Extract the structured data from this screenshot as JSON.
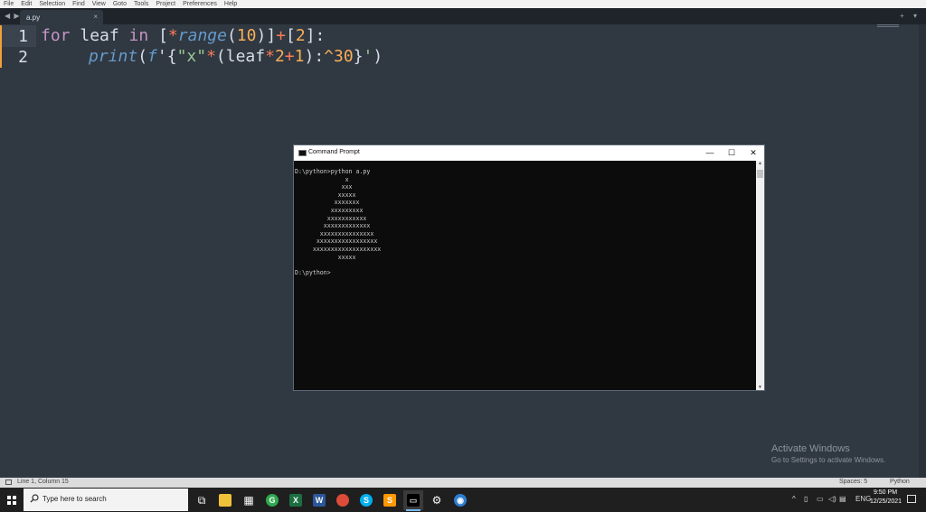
{
  "menu": [
    "File",
    "Edit",
    "Selection",
    "Find",
    "View",
    "Goto",
    "Tools",
    "Project",
    "Preferences",
    "Help"
  ],
  "tab": {
    "name": "a.py",
    "close": "×"
  },
  "nav": {
    "back_forward": "◀ ▶",
    "right_controls": "+ ▾"
  },
  "code": {
    "lines": [
      {
        "number": "1",
        "indent": "",
        "tokens": [
          {
            "t": "for",
            "c": "kw"
          },
          {
            "t": " leaf ",
            "c": "pl"
          },
          {
            "t": "in",
            "c": "kw"
          },
          {
            "t": " [",
            "c": "pl"
          },
          {
            "t": "*",
            "c": "op"
          },
          {
            "t": "range",
            "c": "fn"
          },
          {
            "t": "(",
            "c": "pl"
          },
          {
            "t": "10",
            "c": "num"
          },
          {
            "t": ")]",
            "c": "pl"
          },
          {
            "t": "+",
            "c": "op"
          },
          {
            "t": "[",
            "c": "pl"
          },
          {
            "t": "2",
            "c": "num"
          },
          {
            "t": "]:",
            "c": "pl"
          }
        ]
      },
      {
        "number": "2",
        "tokens": [
          {
            "t": "print",
            "c": "fn"
          },
          {
            "t": "(",
            "c": "pl"
          },
          {
            "t": "f",
            "c": "fn"
          },
          {
            "t": "'{",
            "c": "pl"
          },
          {
            "t": "\"x\"",
            "c": "str"
          },
          {
            "t": "*",
            "c": "op"
          },
          {
            "t": "(leaf",
            "c": "pl"
          },
          {
            "t": "*",
            "c": "op"
          },
          {
            "t": "2",
            "c": "num"
          },
          {
            "t": "+",
            "c": "op"
          },
          {
            "t": "1",
            "c": "num"
          },
          {
            "t": "):",
            "c": "pl"
          },
          {
            "t": "^30",
            "c": "num"
          },
          {
            "t": "}",
            "c": "pl"
          },
          {
            "t": "'",
            "c": "str"
          },
          {
            "t": ")",
            "c": "pl"
          }
        ]
      }
    ]
  },
  "watermark": {
    "line1": "Activate Windows",
    "line2": "Go to Settings to activate Windows."
  },
  "status": {
    "position": "Line 1, Column 15",
    "spaces": "Spaces: 5",
    "syntax": "Python"
  },
  "cmd": {
    "title": "Command Prompt",
    "buttons": {
      "minimize": "—",
      "maximize": "☐",
      "close": "✕"
    },
    "output": [
      "D:\\python>python a.py",
      "              x",
      "             xxx",
      "            xxxxx",
      "           xxxxxxx",
      "          xxxxxxxxx",
      "         xxxxxxxxxxx",
      "        xxxxxxxxxxxxx",
      "       xxxxxxxxxxxxxxx",
      "      xxxxxxxxxxxxxxxxx",
      "     xxxxxxxxxxxxxxxxxxx",
      "            xxxxx",
      "",
      "D:\\python>"
    ]
  },
  "taskbar": {
    "search_placeholder": "Type here to search",
    "apps": [
      {
        "name": "task-view-icon",
        "glyph": "⧉",
        "bg": "transparent",
        "fg": "#ffffff",
        "shape": "plain"
      },
      {
        "name": "file-explorer-icon",
        "glyph": "",
        "bg": "#f0c23a",
        "fg": "#ffffff",
        "shape": "sq"
      },
      {
        "name": "app-grid-icon",
        "glyph": "▦",
        "bg": "transparent",
        "fg": "#ffffff",
        "shape": "plain"
      },
      {
        "name": "green-app-icon",
        "glyph": "G",
        "bg": "#2fa84f",
        "fg": "#ffffff",
        "shape": "circ"
      },
      {
        "name": "excel-icon",
        "glyph": "X",
        "bg": "#1d6f42",
        "fg": "#ffffff",
        "shape": "sq"
      },
      {
        "name": "word-icon",
        "glyph": "W",
        "bg": "#2b579a",
        "fg": "#ffffff",
        "shape": "sq"
      },
      {
        "name": "chrome-icon",
        "glyph": "",
        "bg": "#dd4b39",
        "fg": "#ffffff",
        "shape": "circ"
      },
      {
        "name": "skype-icon",
        "glyph": "S",
        "bg": "#00aff0",
        "fg": "#ffffff",
        "shape": "circ"
      },
      {
        "name": "sublime-text-icon",
        "glyph": "S",
        "bg": "#ff9800",
        "fg": "#ffffff",
        "shape": "sq"
      },
      {
        "name": "command-prompt-icon",
        "glyph": "▭",
        "bg": "#000000",
        "fg": "#cccccc",
        "shape": "sq",
        "active": true
      },
      {
        "name": "settings-gear-icon",
        "glyph": "⚙",
        "bg": "transparent",
        "fg": "#ffffff",
        "shape": "plain"
      },
      {
        "name": "blue-app-icon",
        "glyph": "◉",
        "bg": "#2d7dd2",
        "fg": "#ffffff",
        "shape": "circ"
      }
    ],
    "tray": {
      "chevron": "^",
      "lang": "ENG",
      "time": "9:50 PM",
      "date": "12/25/2021"
    }
  }
}
